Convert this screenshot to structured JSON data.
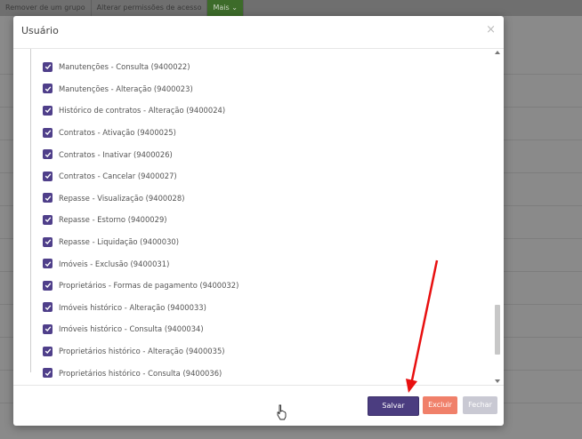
{
  "background": {
    "toolbar": [
      {
        "label": "Remover de um grupo"
      },
      {
        "label": "Alterar permissões de acesso"
      },
      {
        "label": "Mais ⌄"
      }
    ]
  },
  "modal": {
    "title": "Usuário",
    "close_symbol": "×",
    "permissions": [
      {
        "label": "Manutenções - Consulta (9400022)",
        "checked": true
      },
      {
        "label": "Manutenções - Alteração (9400023)",
        "checked": true
      },
      {
        "label": "Histórico de contratos - Alteração (9400024)",
        "checked": true
      },
      {
        "label": "Contratos - Ativação (9400025)",
        "checked": true
      },
      {
        "label": "Contratos - Inativar (9400026)",
        "checked": true
      },
      {
        "label": "Contratos - Cancelar (9400027)",
        "checked": true
      },
      {
        "label": "Repasse - Visualização (9400028)",
        "checked": true
      },
      {
        "label": "Repasse - Estorno (9400029)",
        "checked": true
      },
      {
        "label": "Repasse - Liquidação (9400030)",
        "checked": true
      },
      {
        "label": "Imóveis - Exclusão (9400031)",
        "checked": true
      },
      {
        "label": "Proprietários - Formas de pagamento (9400032)",
        "checked": true
      },
      {
        "label": "Imóveis histórico - Alteração (9400033)",
        "checked": true
      },
      {
        "label": "Imóveis histórico - Consulta (9400034)",
        "checked": true
      },
      {
        "label": "Proprietários histórico - Alteração (9400035)",
        "checked": true
      },
      {
        "label": "Proprietários histórico - Consulta (9400036)",
        "checked": true
      }
    ],
    "footer": {
      "save_label": "Salvar",
      "delete_label": "Excluir",
      "close_label": "Fechar"
    }
  },
  "colors": {
    "accent": "#4b3d80",
    "danger": "#f0806a",
    "disabled": "#c9c9d3",
    "annotation": "#e81010"
  }
}
